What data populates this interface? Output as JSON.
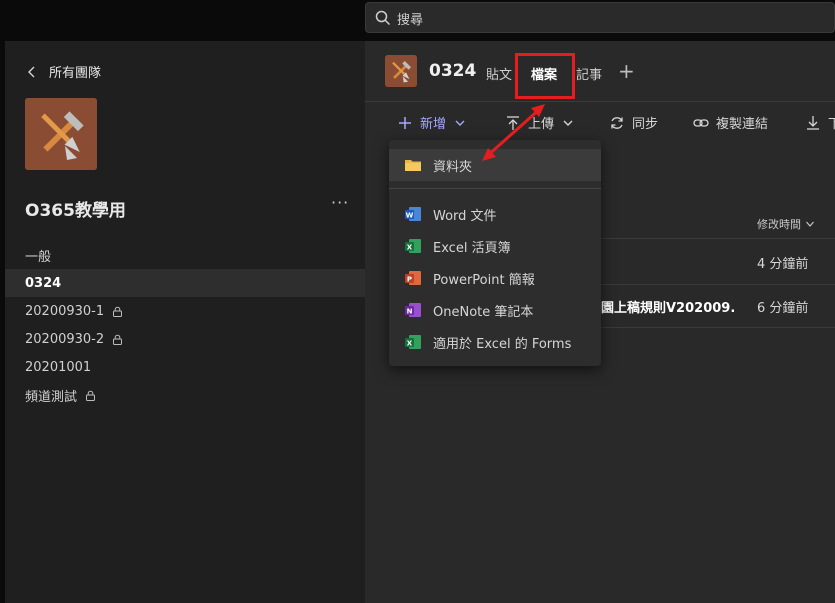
{
  "search": {
    "placeholder": "搜尋"
  },
  "sidebar": {
    "back_label": "所有團隊",
    "team_name": "O365教學用",
    "more": "···",
    "channels": [
      {
        "label": "一般",
        "locked": false,
        "active": false
      },
      {
        "label": "0324",
        "locked": false,
        "active": true
      },
      {
        "label": "20200930-1",
        "locked": true,
        "active": false
      },
      {
        "label": "20200930-2",
        "locked": true,
        "active": false
      },
      {
        "label": "20201001",
        "locked": false,
        "active": false
      },
      {
        "label": "頻道測試",
        "locked": true,
        "active": false
      }
    ]
  },
  "header": {
    "title": "0324",
    "tabs": [
      {
        "label": "貼文",
        "active": false
      },
      {
        "label": "檔案",
        "active": true
      },
      {
        "label": "記事",
        "active": false
      }
    ],
    "add_tab": "+"
  },
  "toolbar": {
    "new_label": "新增",
    "upload_label": "上傳",
    "sync_label": "同步",
    "copy_link_label": "複製連結",
    "download_label": "下"
  },
  "files": {
    "modified_header": "修改時間",
    "rows": [
      {
        "name": "",
        "modified": "4 分鐘前"
      },
      {
        "name": "園上稿規則V202009...",
        "modified": "6 分鐘前"
      }
    ]
  },
  "new_menu": {
    "items": [
      {
        "label": "資料夾",
        "icon": "folder-icon"
      },
      {
        "label": "Word 文件",
        "icon": "word-icon"
      },
      {
        "label": "Excel 活頁簿",
        "icon": "excel-icon"
      },
      {
        "label": "PowerPoint 簡報",
        "icon": "powerpoint-icon"
      },
      {
        "label": "OneNote 筆記本",
        "icon": "onenote-icon"
      },
      {
        "label": "適用於 Excel 的 Forms",
        "icon": "excel-icon"
      }
    ]
  },
  "colors": {
    "accent": "#7f85f5",
    "annotation_red": "#e41e1e",
    "team_avatar_bg": "#8a4d33"
  }
}
